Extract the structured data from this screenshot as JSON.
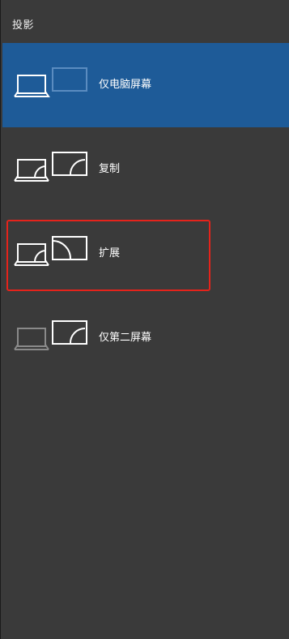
{
  "panel": {
    "title": "投影"
  },
  "options": [
    {
      "label": "仅电脑屏幕",
      "icon": "pc-screen-only-icon",
      "selected": true
    },
    {
      "label": "复制",
      "icon": "duplicate-icon",
      "selected": false
    },
    {
      "label": "扩展",
      "icon": "extend-icon",
      "selected": false,
      "highlighted": true
    },
    {
      "label": "仅第二屏幕",
      "icon": "second-screen-only-icon",
      "selected": false
    }
  ],
  "colors": {
    "panel_bg": "#3a3a3a",
    "selected_bg": "#1e5b98",
    "highlight_border": "#e5231b",
    "icon_active": "#ffffff",
    "icon_dim_blue": "#5b8cc0",
    "icon_dim_gray": "#8a8a8a"
  }
}
